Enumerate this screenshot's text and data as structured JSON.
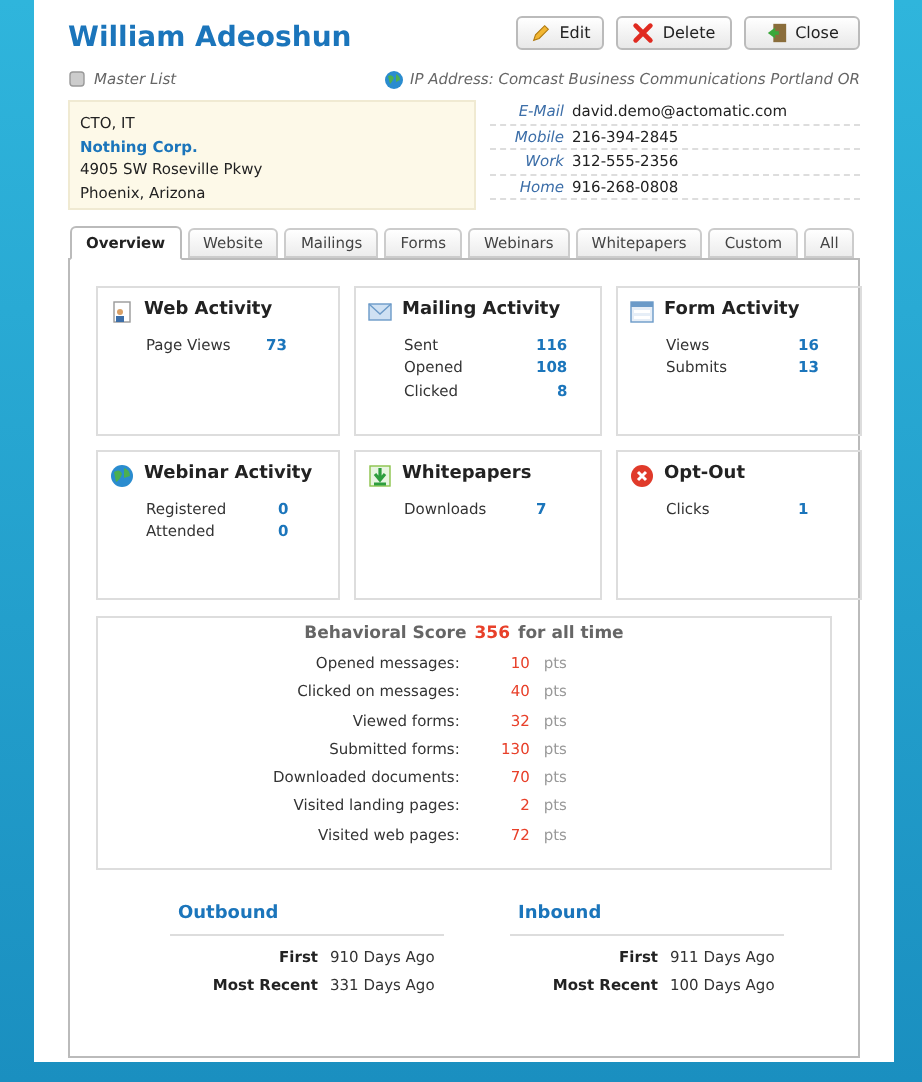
{
  "contact": {
    "name": "William Adeoshun",
    "list": "Master List",
    "ip": "IP Address: Comcast Business Communications Portland OR",
    "title": "CTO, IT",
    "company": "Nothing Corp.",
    "street": "4905 SW Roseville Pkwy",
    "city": "Phoenix, Arizona"
  },
  "buttons": [
    {
      "label": "Edit",
      "kind": "edit"
    },
    {
      "label": "Delete",
      "kind": "delete"
    },
    {
      "label": "Close",
      "kind": "close"
    }
  ],
  "contact_fields": [
    {
      "label": "E-Mail",
      "value": "david.demo@actomatic.com"
    },
    {
      "label": "Mobile",
      "value": "216-394-2845"
    },
    {
      "label": "Work",
      "value": "312-555-2356"
    },
    {
      "label": "Home",
      "value": "916-268-0808"
    }
  ],
  "tabs": [
    {
      "label": "Overview",
      "selected": true
    },
    {
      "label": "Website",
      "selected": false
    },
    {
      "label": "Mailings",
      "selected": false
    },
    {
      "label": "Forms",
      "selected": false
    },
    {
      "label": "Webinars",
      "selected": false
    },
    {
      "label": "Whitepapers",
      "selected": false
    },
    {
      "label": "Custom",
      "selected": false
    },
    {
      "label": "All",
      "selected": false
    }
  ],
  "activity_cards": [
    {
      "title": "Web Activity",
      "kind": "web",
      "stats": [
        {
          "label": "Page Views",
          "value": "73"
        }
      ]
    },
    {
      "title": "Mailing Activity",
      "kind": "mail",
      "stats": [
        {
          "label": "Sent",
          "value": "116"
        },
        {
          "label": "Opened",
          "value": "108"
        },
        {
          "label": "Clicked",
          "value": "8"
        }
      ]
    },
    {
      "title": "Form Activity",
      "kind": "form",
      "stats": [
        {
          "label": "Views",
          "value": "16"
        },
        {
          "label": "Submits",
          "value": "13"
        }
      ]
    },
    {
      "title": "Webinar Activity",
      "kind": "webinar",
      "stats": [
        {
          "label": "Registered",
          "value": "0"
        },
        {
          "label": "Attended",
          "value": "0"
        }
      ]
    },
    {
      "title": "Whitepapers",
      "kind": "whitepaper",
      "stats": [
        {
          "label": "Downloads",
          "value": "7"
        }
      ]
    },
    {
      "title": "Opt-Out",
      "kind": "optout",
      "stats": [
        {
          "label": "Clicks",
          "value": "1"
        }
      ]
    }
  ],
  "behavioral_score": {
    "label": "Behavioral Score",
    "score": "356",
    "period": "for all time",
    "rows": [
      {
        "label": "Opened messages:",
        "points": "10",
        "unit": "pts"
      },
      {
        "label": "Clicked on messages:",
        "points": "40",
        "unit": "pts"
      },
      {
        "label": "Viewed forms:",
        "points": "32",
        "unit": "pts"
      },
      {
        "label": "Submitted forms:",
        "points": "130",
        "unit": "pts"
      },
      {
        "label": "Downloaded documents:",
        "points": "70",
        "unit": "pts"
      },
      {
        "label": "Visited landing pages:",
        "points": "2",
        "unit": "pts"
      },
      {
        "label": "Visited web pages:",
        "points": "72",
        "unit": "pts"
      }
    ]
  },
  "interactions": [
    {
      "title": "Outbound",
      "rows": [
        {
          "label": "First",
          "value": "910 Days Ago"
        },
        {
          "label": "Most Recent",
          "value": "331 Days Ago"
        }
      ]
    },
    {
      "title": "Inbound",
      "rows": [
        {
          "label": "First",
          "value": "911 Days Ago"
        },
        {
          "label": "Most Recent",
          "value": "100 Days Ago"
        }
      ]
    }
  ]
}
